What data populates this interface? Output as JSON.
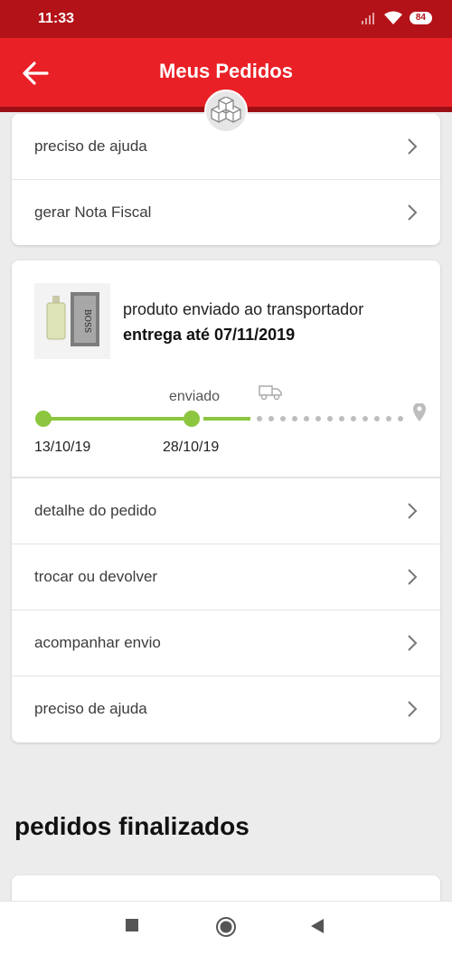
{
  "status_bar": {
    "time": "11:33",
    "battery": "84"
  },
  "app_bar": {
    "title": "Meus Pedidos"
  },
  "colors": {
    "brand": "#ea2027",
    "status_dark": "#b31218",
    "timeline_green": "#8cc63f",
    "timeline_pending": "#bdbdbd"
  },
  "card_top": {
    "rows": [
      {
        "label": "preciso de ajuda"
      },
      {
        "label": "gerar Nota Fiscal"
      }
    ]
  },
  "order": {
    "status": "produto enviado ao transportador",
    "delivery": "entrega até 07/11/2019",
    "product_image": "perfume-bottle-boss",
    "timeline": {
      "current_step_label": "enviado",
      "dates": [
        "13/10/19",
        "28/10/19"
      ],
      "icons": [
        "truck-icon",
        "location-pin-icon"
      ]
    },
    "rows": [
      {
        "label": "detalhe do pedido"
      },
      {
        "label": "trocar ou devolver"
      },
      {
        "label": "acompanhar envio"
      },
      {
        "label": "preciso de ajuda"
      }
    ]
  },
  "finished": {
    "title": "pedidos finalizados"
  },
  "nav": {
    "icons": [
      "square-icon",
      "circle-icon",
      "back-triangle-icon"
    ]
  }
}
